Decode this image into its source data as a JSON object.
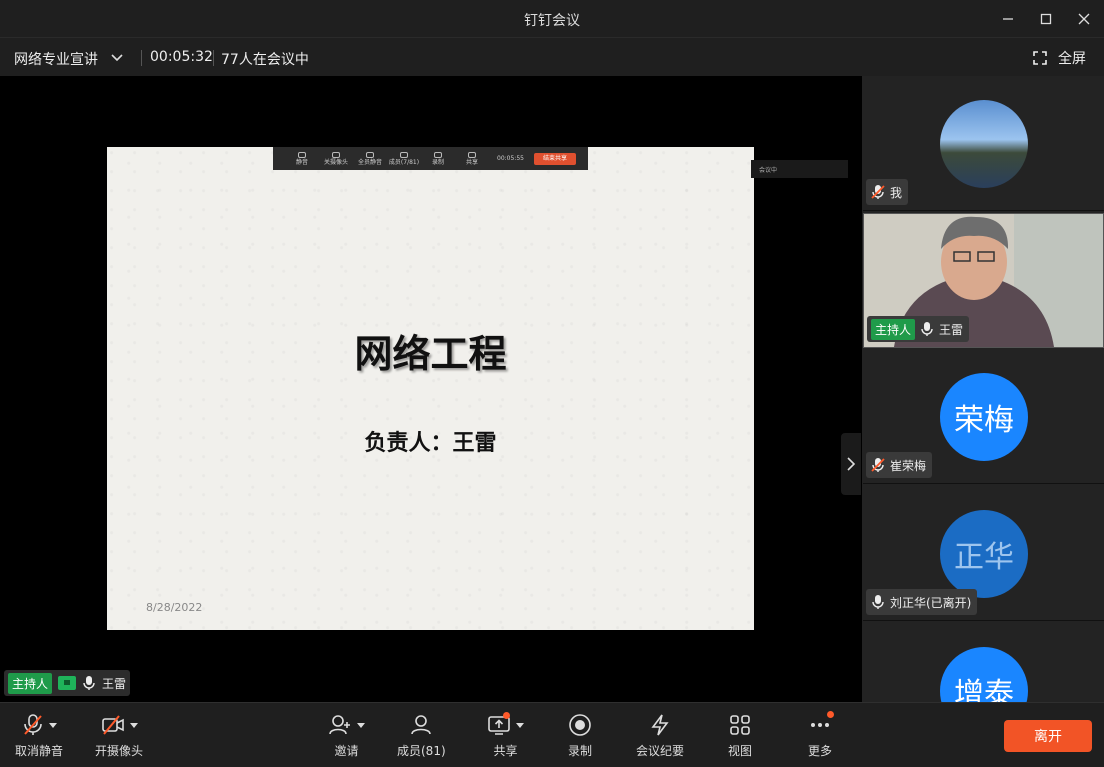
{
  "window": {
    "title": "钉钉会议"
  },
  "info": {
    "meeting_name": "网络专业宣讲",
    "elapsed": "00:05:32",
    "participants_text": "77人在会议中",
    "fullscreen_label": "全屏"
  },
  "slide": {
    "title": "网络工程",
    "subtitle": "负责人：王雷",
    "date": "8/28/2022"
  },
  "mini_toolbar": {
    "items": [
      "静音",
      "关摄像头",
      "全员静音",
      "成员(7/81)",
      "录制",
      "共享"
    ],
    "time": "00:05:55",
    "stop": "结束共享"
  },
  "mini_panel": {
    "text": "会议中"
  },
  "host_tag": {
    "badge": "主持人",
    "name": "王雷"
  },
  "sidebar": {
    "tiles": [
      {
        "name": "我",
        "avatar_text": "",
        "muted": true
      },
      {
        "name": "王雷",
        "badge": "主持人",
        "muted": false
      },
      {
        "name": "崔荣梅",
        "avatar_text": "荣梅",
        "muted": true
      },
      {
        "name": "刘正华(已离开)",
        "avatar_text": "正华",
        "muted": false
      },
      {
        "name": "",
        "avatar_text": "增泰",
        "muted": false
      }
    ]
  },
  "toolbar": {
    "unmute": "取消静音",
    "camera": "开摄像头",
    "invite": "邀请",
    "members": "成员(81)",
    "share": "共享",
    "record": "录制",
    "minutes": "会议纪要",
    "view": "视图",
    "more": "更多",
    "leave": "离开"
  },
  "colors": {
    "accent_blue": "#1a86ff",
    "leave_red": "#f25426",
    "host_green": "#1f9b4a"
  }
}
